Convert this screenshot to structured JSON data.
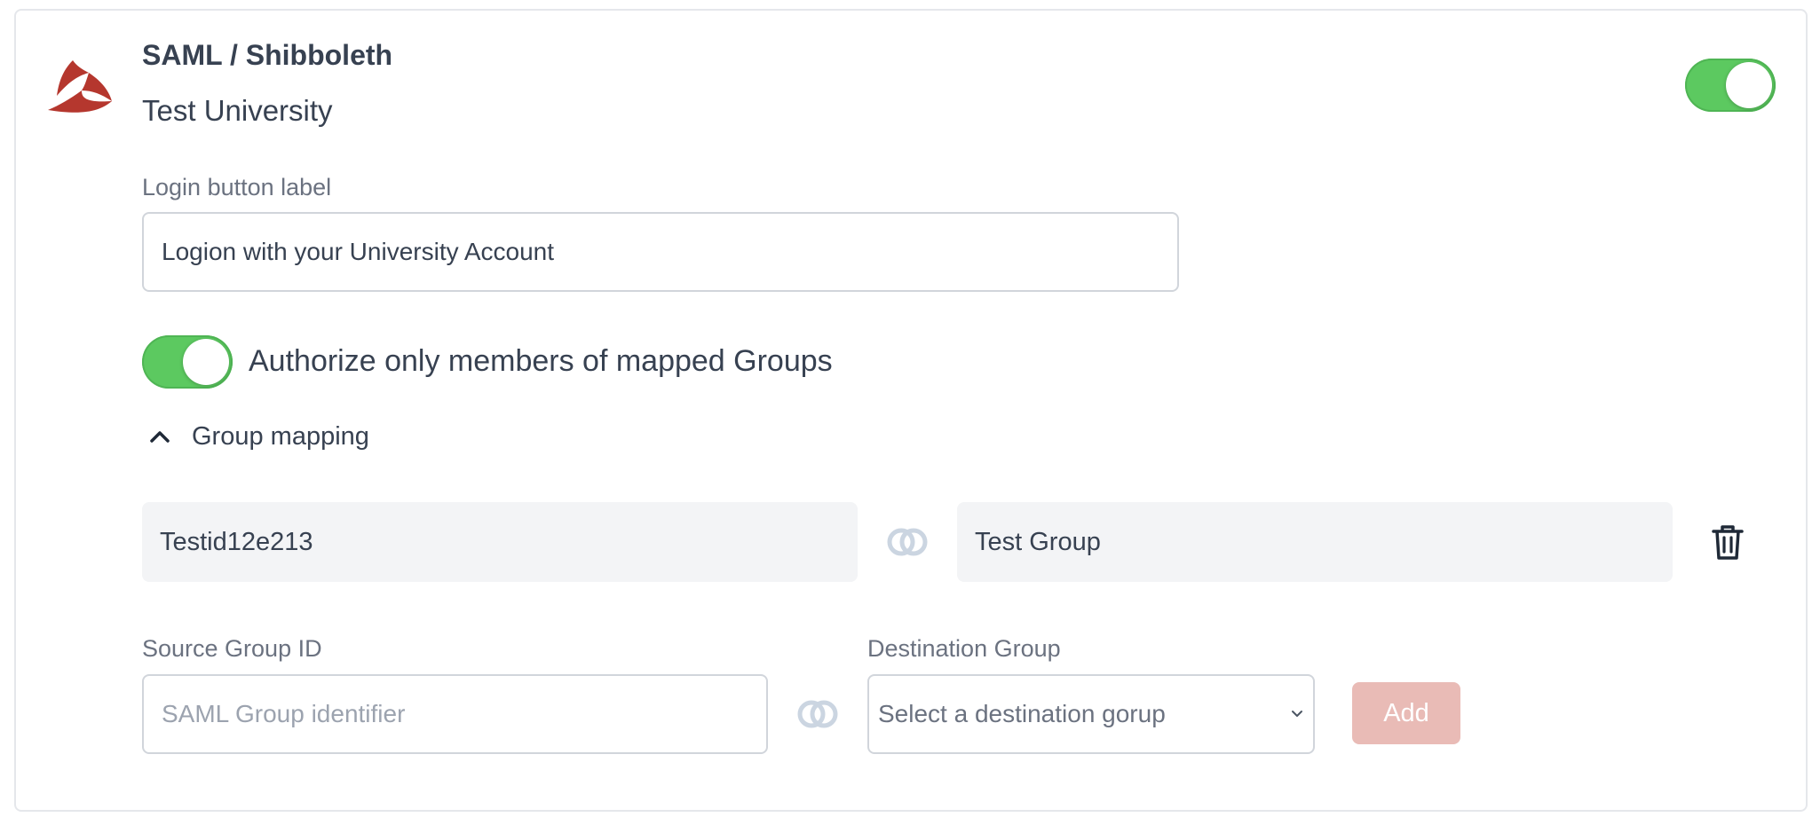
{
  "provider": {
    "name": "SAML / Shibboleth",
    "organization": "Test University",
    "enabled": true,
    "logo_icon": "shibboleth-logo",
    "brand_color": "#b5372e"
  },
  "login_button": {
    "label": "Login button label",
    "value": "Logion with your University Account"
  },
  "authorization": {
    "label": "Authorize only members of mapped Groups",
    "enabled": true
  },
  "group_mapping": {
    "title": "Group mapping",
    "expanded": true,
    "toggle_icon": "chevron-up-icon",
    "mappings": [
      {
        "source": "Testid12e213",
        "destination": "Test Group"
      }
    ],
    "new_mapping": {
      "source_label": "Source Group ID",
      "source_placeholder": "SAML Group identifier",
      "destination_label": "Destination Group",
      "destination_placeholder": "Select a destination gorup",
      "add_label": "Add"
    }
  },
  "colors": {
    "toggle_on": "#5cc960",
    "add_button_disabled": "#e9bbb6",
    "mapping_background": "#f3f4f6"
  }
}
